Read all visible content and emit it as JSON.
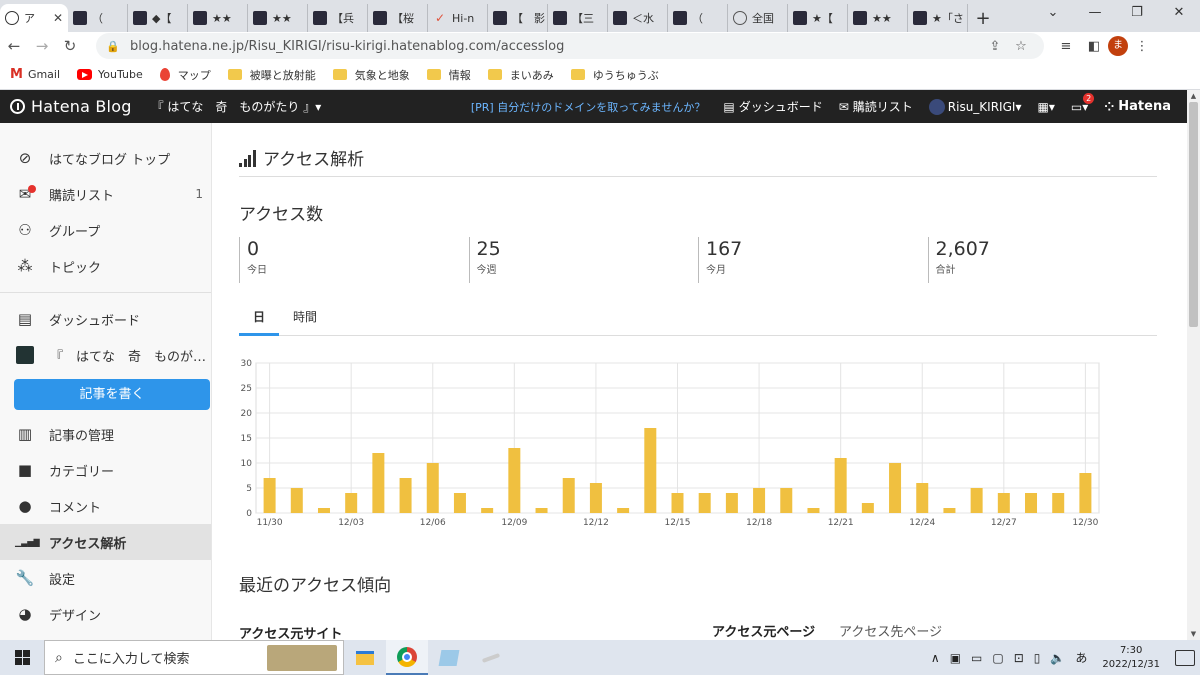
{
  "browser": {
    "tabs": [
      {
        "title": "ア",
        "icon": "hatena-icon",
        "active": true
      },
      {
        "title": "（",
        "icon": "blog-icon"
      },
      {
        "title": "◆【",
        "icon": "blog-icon"
      },
      {
        "title": "★★",
        "icon": "blog-icon"
      },
      {
        "title": "★★",
        "icon": "blog-icon"
      },
      {
        "title": "【兵",
        "icon": "blog-icon"
      },
      {
        "title": "【桜",
        "icon": "blog-icon"
      },
      {
        "title": "Hi-n",
        "icon": "check-icon"
      },
      {
        "title": "【　影",
        "icon": "blog-icon"
      },
      {
        "title": "【三",
        "icon": "blog-icon"
      },
      {
        "title": "＜水",
        "icon": "blog-icon"
      },
      {
        "title": "（　",
        "icon": "blog-icon"
      },
      {
        "title": "全国",
        "icon": "globe-icon"
      },
      {
        "title": "★【",
        "icon": "blog-icon"
      },
      {
        "title": "★★",
        "icon": "blog-icon"
      },
      {
        "title": "★「さ",
        "icon": "blog-icon"
      }
    ],
    "url": "blog.hatena.ne.jp/Risu_KIRIGI/risu-kirigi.hatenablog.com/accesslog",
    "profile_initial": "ま",
    "bookmarks": [
      {
        "label": "Gmail",
        "icon": "gmail-icon"
      },
      {
        "label": "YouTube",
        "icon": "youtube-icon"
      },
      {
        "label": "マップ",
        "icon": "maps-icon"
      },
      {
        "label": "被曝と放射能",
        "icon": "folder-icon"
      },
      {
        "label": "気象と地象",
        "icon": "folder-icon"
      },
      {
        "label": "情報",
        "icon": "folder-icon"
      },
      {
        "label": "まいあみ",
        "icon": "folder-icon"
      },
      {
        "label": "ゆうちゅうぶ",
        "icon": "folder-icon"
      }
    ]
  },
  "header": {
    "logo": "Hatena Blog",
    "blog_name": "『 はてな　奇　ものがたり 』▾",
    "pr": "[PR] 自分だけのドメインを取ってみませんか？",
    "dashboard": "ダッシュボード",
    "subscriptions": "購読リスト",
    "user": "Risu_KIRIGI",
    "notifications": "2",
    "hatena": "Hatena"
  },
  "sidebar": {
    "items": [
      {
        "label": "はてなブログ トップ",
        "icon": "compass-icon"
      },
      {
        "label": "購読リスト",
        "icon": "subscribe-icon",
        "count": "1"
      },
      {
        "label": "グループ",
        "icon": "group-icon"
      },
      {
        "label": "トピック",
        "icon": "topic-icon"
      }
    ],
    "items2": [
      {
        "label": "ダッシュボード",
        "icon": "dashboard-icon"
      },
      {
        "label": "『　はてな　奇　ものが…",
        "icon": "blog-thumb-icon"
      }
    ],
    "write_button": "記事を書く",
    "items3": [
      {
        "label": "記事の管理",
        "icon": "document-icon"
      },
      {
        "label": "カテゴリー",
        "icon": "folder-icon"
      },
      {
        "label": "コメント",
        "icon": "comment-icon"
      },
      {
        "label": "アクセス解析",
        "icon": "signal-icon",
        "active": true
      },
      {
        "label": "設定",
        "icon": "wrench-icon"
      },
      {
        "label": "デザイン",
        "icon": "palette-icon"
      }
    ]
  },
  "main": {
    "title": "アクセス解析",
    "access_title": "アクセス数",
    "stats": [
      {
        "value": "0",
        "label": "今日"
      },
      {
        "value": "25",
        "label": "今週"
      },
      {
        "value": "167",
        "label": "今月"
      },
      {
        "value": "2,607",
        "label": "合計"
      }
    ],
    "tabs": [
      "日",
      "時間"
    ],
    "recent_title": "最近のアクセス傾向",
    "source_sites": "アクセス元サイト",
    "source_pages": "アクセス元ページ",
    "dest_pages": "アクセス先ページ"
  },
  "chart_data": {
    "type": "bar",
    "categories": [
      "11/30",
      "12/01",
      "12/02",
      "12/03",
      "12/04",
      "12/05",
      "12/06",
      "12/07",
      "12/08",
      "12/09",
      "12/10",
      "12/11",
      "12/12",
      "12/13",
      "12/14",
      "12/15",
      "12/16",
      "12/17",
      "12/18",
      "12/19",
      "12/20",
      "12/21",
      "12/22",
      "12/23",
      "12/24",
      "12/25",
      "12/26",
      "12/27",
      "12/28",
      "12/29",
      "12/30"
    ],
    "tick_labels": [
      "11/30",
      "12/03",
      "12/06",
      "12/09",
      "12/12",
      "12/15",
      "12/18",
      "12/21",
      "12/24",
      "12/27",
      "12/30"
    ],
    "values": [
      7,
      5,
      1,
      4,
      12,
      7,
      10,
      4,
      1,
      13,
      1,
      7,
      6,
      1,
      17,
      4,
      4,
      4,
      5,
      5,
      1,
      11,
      2,
      10,
      6,
      1,
      5,
      4,
      4,
      4,
      8
    ],
    "yticks": [
      0,
      5,
      10,
      15,
      20,
      25,
      30
    ],
    "ylim": [
      0,
      30
    ],
    "bar_color": "#f0c040",
    "grid": true
  },
  "taskbar": {
    "search_placeholder": "ここに入力して検索",
    "time": "7:30",
    "date": "2022/12/31",
    "ime": "あ"
  }
}
